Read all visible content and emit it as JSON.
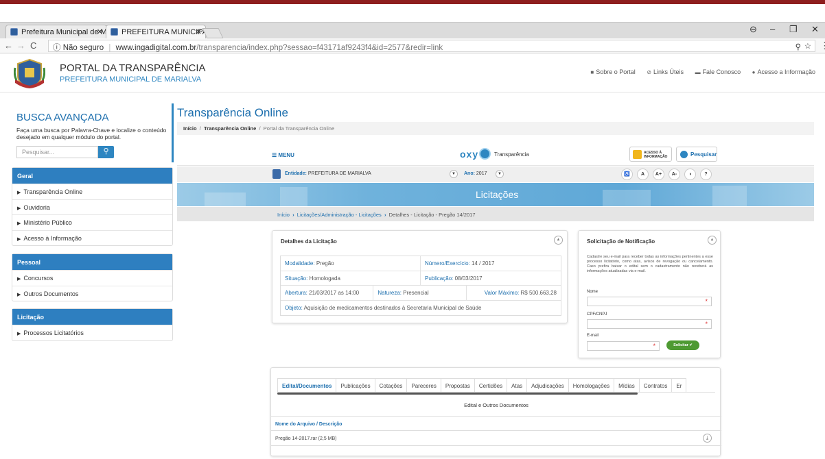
{
  "browser": {
    "tabs": [
      {
        "label": "Prefeitura Municipal de M"
      },
      {
        "label": "PREFEITURA MUNICIPAL"
      }
    ],
    "url_host": "www.ingadigital.com.br",
    "url_path": "/transparencia/index.php?sessao=f43171af9243f4&id=2577&redir=link",
    "security_label": "Não seguro"
  },
  "site": {
    "title": "PORTAL DA TRANSPARÊNCIA",
    "subtitle": "PREFEITURA MUNICIPAL DE MARIALVA",
    "links": [
      "Sobre o Portal",
      "Links Úteis",
      "Fale Conosco",
      "Acesso a Informação"
    ]
  },
  "sidebar": {
    "title": "BUSCA AVANÇADA",
    "description": "Faça uma busca por Palavra-Chave e localize o conteúdo desejado em qualquer módulo do portal.",
    "search_placeholder": "Pesquisar...",
    "groups": [
      {
        "title": "Geral",
        "items": [
          "Transparência Online",
          "Ouvidoria",
          "Ministério Público",
          "Acesso à Informação"
        ]
      },
      {
        "title": "Pessoal",
        "items": [
          "Concursos",
          "Outros Documentos"
        ]
      },
      {
        "title": "Licitação",
        "items": [
          "Processos Licitatórios"
        ]
      }
    ]
  },
  "main": {
    "title": "Transparência Online",
    "breadcrumb": {
      "home": "Início",
      "section": "Transparência Online",
      "current": "Portal da Transparência Online"
    },
    "menu_label": "MENU",
    "brand": "oxy",
    "brand_label": "Transparência",
    "acesso_label": "ACESSO À INFORMAÇÃO",
    "pesquisar_label": "Pesquisar",
    "entity_label": "Entidade:",
    "entity_value": "PREFEITURA DE MARIALVA",
    "ano_label": "Ano:",
    "ano_value": "2017",
    "access_buttons": [
      "A",
      "A+",
      "A-",
      "?"
    ],
    "banner_title": "Licitações",
    "breadcrumb2": {
      "home": "Início",
      "section": "Licitações/Administração - Licitações",
      "current": "Detalhes - Licitação - Pregão 14/2017"
    }
  },
  "details": {
    "title": "Detalhes da Licitação",
    "modalidade_label": "Modalidade:",
    "modalidade": "Pregão",
    "numero_label": "Número/Exercício:",
    "numero": "14 / 2017",
    "situacao_label": "Situação:",
    "situacao": "Homologada",
    "publicacao_label": "Publicação:",
    "publicacao": "08/03/2017",
    "abertura_label": "Abertura:",
    "abertura": "21/03/2017 as 14:00",
    "natureza_label": "Natureza:",
    "natureza": "Presencial",
    "valor_label": "Valor Máximo:",
    "valor": "R$ 500.663,28",
    "objeto_label": "Objeto:",
    "objeto": "Aquisição de medicamentos destinados à Secretaria Municipal de Saúde"
  },
  "notification": {
    "title": "Solicitação de Notificação",
    "text": "Cadastre seu e-mail para receber todas as informações pertinentes a esse processo licitatório, como atas, avisos de revogação ou cancelamento. Caso prefira baixar o edital sem o cadastramento não receberá as informações atualizadas via e-mail.",
    "nome_label": "Nome",
    "cpf_label": "CPF/CNPJ",
    "email_label": "E-mail",
    "submit_label": "Solicitar ✔"
  },
  "documents": {
    "tabs": [
      "Edital/Documentos",
      "Publicações",
      "Cotações",
      "Pareceres",
      "Propostas",
      "Certidões",
      "Atas",
      "Adjudicações",
      "Homologações",
      "Mídias",
      "Contratos",
      "Er"
    ],
    "section_title": "Edital e Outros Documentos",
    "column_header": "Nome do Arquivo / Descrição",
    "files": [
      "Pregão 14-2017.rar (2,5 MB)"
    ]
  }
}
